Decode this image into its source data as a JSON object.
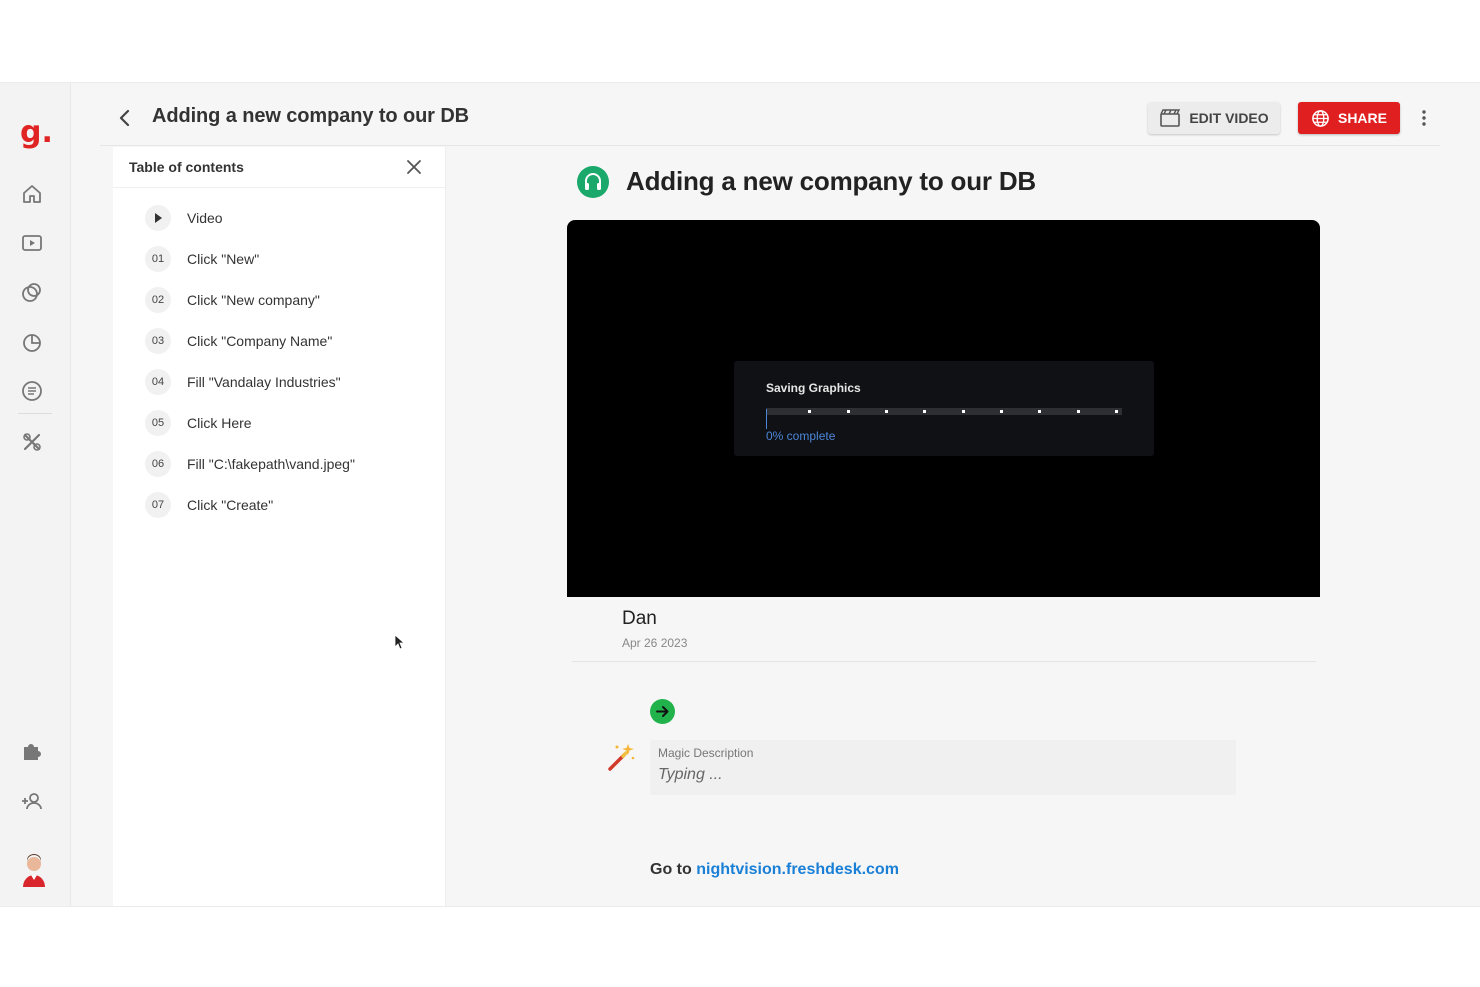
{
  "header": {
    "title": "Adding a new company to our DB",
    "edit_label": "EDIT VIDEO",
    "share_label": "SHARE"
  },
  "logo": "g.",
  "toc": {
    "title": "Table of contents",
    "items": [
      {
        "num": "",
        "label": "Video"
      },
      {
        "num": "01",
        "label": "Click \"New\""
      },
      {
        "num": "02",
        "label": "Click \"New company\""
      },
      {
        "num": "03",
        "label": "Click \"Company Name\""
      },
      {
        "num": "04",
        "label": "Fill \"Vandalay Industries\""
      },
      {
        "num": "05",
        "label": "Click Here"
      },
      {
        "num": "06",
        "label": "Fill \"C:\\fakepath\\vand.jpeg\""
      },
      {
        "num": "07",
        "label": "Click \"Create\""
      }
    ]
  },
  "main": {
    "title": "Adding a new company to our DB",
    "video": {
      "saving_title": "Saving Graphics",
      "progress_label": "0% complete",
      "progress_fraction": 0
    },
    "author": "Dan",
    "date": "Apr 26 2023",
    "magic": {
      "label": "Magic Description",
      "placeholder": "Typing ..."
    },
    "goto": {
      "prefix": "Go to",
      "link": "nightvision.freshdesk.com"
    }
  },
  "colors": {
    "brand_red": "#e02020",
    "accent_green": "#1aa86b",
    "link_blue": "#1a7fd6",
    "progress_blue": "#4c86d8"
  },
  "icons": {
    "rail": [
      "home-icon",
      "video-library-icon",
      "shapes-icon",
      "pie-chart-icon",
      "list-icon",
      "tools-icon",
      "puzzle-icon",
      "add-user-icon"
    ]
  }
}
